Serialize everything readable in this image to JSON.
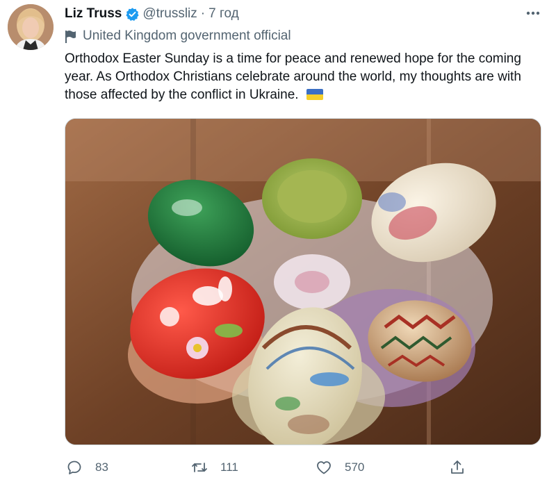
{
  "tweet": {
    "author_name": "Liz Truss",
    "handle": "@trussliz",
    "separator": "·",
    "time": "7 год",
    "account_label": "United Kingdom government official",
    "text": "Orthodox Easter Sunday is a time for peace and renewed hope for the coming year. As Orthodox Christians celebrate around the world, my thoughts are with those affected by the conflict in Ukraine.",
    "flag_colors": {
      "top": "#3b6fc4",
      "bottom": "#f5cf2a"
    },
    "verified_color": "#1d9bf0",
    "media_icon": "photo-of-painted-easter-eggs"
  },
  "actions": {
    "reply": {
      "icon": "reply-icon",
      "count": "83"
    },
    "retweet": {
      "icon": "retweet-icon",
      "count": "111"
    },
    "like": {
      "icon": "heart-icon",
      "count": "570"
    },
    "share": {
      "icon": "share-icon"
    }
  }
}
